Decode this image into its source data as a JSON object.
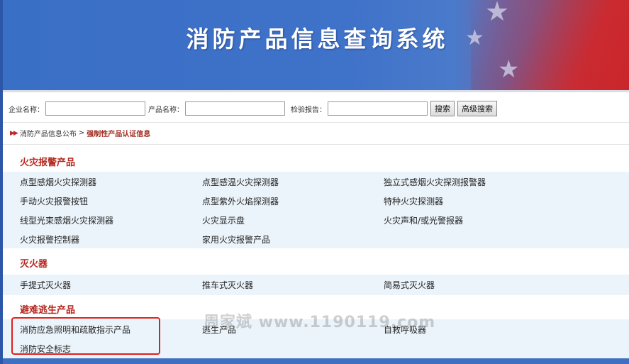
{
  "header": {
    "title": "消防产品信息查询系统"
  },
  "search": {
    "company_label": "企业名称：",
    "product_label": "产品名称：",
    "report_label": "检验报告：",
    "company_value": "",
    "product_value": "",
    "report_value": "",
    "search_button": "搜索",
    "advanced_button": "高级搜索"
  },
  "breadcrumb": {
    "parent": "消防产品信息公布",
    "separator": ">",
    "current": "强制性产品认证信息"
  },
  "categories": [
    {
      "title": "火灾报警产品",
      "rows": [
        [
          "点型感烟火灾探测器",
          "点型感温火灾探测器",
          "独立式感烟火灾探测报警器"
        ],
        [
          "手动火灾报警按钮",
          "点型紫外火焰探测器",
          "特种火灾探测器"
        ],
        [
          "线型光束感烟火灾探测器",
          "火灾显示盘",
          "火灾声和/或光警报器"
        ],
        [
          "火灾报警控制器",
          "家用火灾报警产品",
          ""
        ]
      ]
    },
    {
      "title": "灭火器",
      "rows": [
        [
          "手提式灭火器",
          "推车式灭火器",
          "简易式灭火器"
        ]
      ]
    },
    {
      "title": "避难逃生产品",
      "rows": [
        [
          "消防应急照明和疏散指示产品",
          "逃生产品",
          "自救呼吸器"
        ],
        [
          "消防安全标志",
          "",
          ""
        ]
      ]
    }
  ],
  "watermark": "周家斌 www.1190119.com",
  "colors": {
    "banner_blue": "#3f72c9",
    "category_title": "#b5261e",
    "row_background": "#ebf4fb",
    "highlight_border": "#e0201c"
  }
}
